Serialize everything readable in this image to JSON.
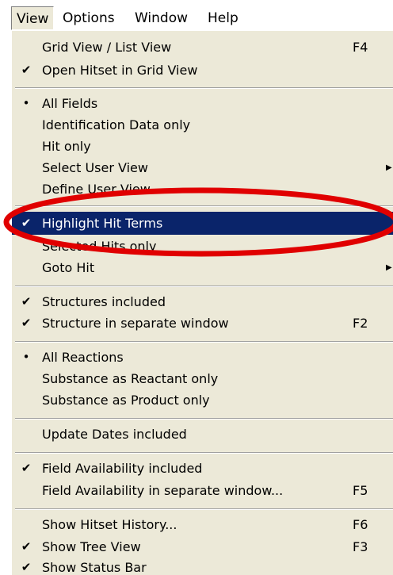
{
  "menubar": {
    "items": [
      {
        "label": "View"
      },
      {
        "label": "Options"
      },
      {
        "label": "Window"
      },
      {
        "label": "Help"
      }
    ]
  },
  "menu": {
    "grid_list_view": {
      "label": "Grid View / List View",
      "shortcut": "F4"
    },
    "open_hitset_grid": {
      "label": "Open Hitset in Grid View",
      "check": "✔"
    },
    "all_fields": {
      "label": "All Fields",
      "bullet": "•"
    },
    "identification_only": {
      "label": "Identification Data only"
    },
    "hit_only": {
      "label": "Hit only"
    },
    "select_user_view": {
      "label": "Select User View",
      "arrow": "▶"
    },
    "define_user_view": {
      "label": "Define User View..."
    },
    "highlight_hit_terms": {
      "label": "Highlight Hit Terms",
      "check": "✔"
    },
    "selected_hits_only": {
      "label": "Selected Hits only"
    },
    "goto_hit": {
      "label": "Goto Hit",
      "arrow": "▶"
    },
    "structures_included": {
      "label": "Structures included",
      "check": "✔"
    },
    "structure_separate": {
      "label": "Structure in separate window",
      "shortcut": "F2",
      "check": "✔"
    },
    "all_reactions": {
      "label": "All Reactions",
      "bullet": "•"
    },
    "substance_reactant": {
      "label": "Substance as Reactant only"
    },
    "substance_product": {
      "label": "Substance as Product only"
    },
    "update_dates": {
      "label": "Update Dates included"
    },
    "field_availability_included": {
      "label": "Field Availability included",
      "check": "✔"
    },
    "field_availability_separate": {
      "label": "Field Availability in separate window...",
      "shortcut": "F5"
    },
    "show_hitset_history": {
      "label": "Show Hitset History...",
      "shortcut": "F6"
    },
    "show_tree_view": {
      "label": "Show Tree View",
      "shortcut": "F3",
      "check": "✔"
    },
    "show_status_bar": {
      "label": "Show Status Bar",
      "check": "✔"
    }
  },
  "colors": {
    "menu_bg": "#ece9d8",
    "highlight_bg": "#0a246a",
    "annotation": "#e00000"
  }
}
